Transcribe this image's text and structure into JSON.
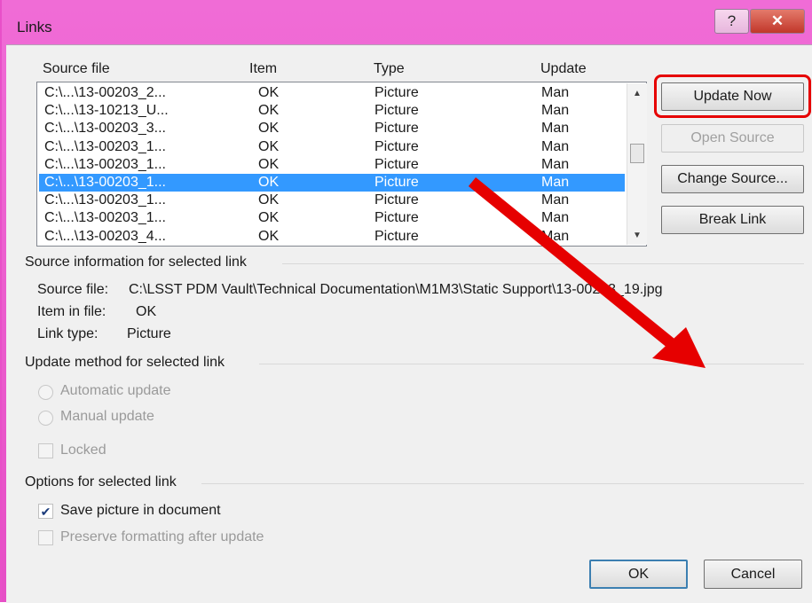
{
  "window": {
    "title": "Links",
    "help_label": "?",
    "close_label": "✕"
  },
  "list": {
    "headers": {
      "source_file": "Source file",
      "item": "Item",
      "type": "Type",
      "update": "Update"
    },
    "selected_index": 5,
    "rows": [
      {
        "source": "C:\\...\\13-00203_2...",
        "item": "OK",
        "type": "Picture",
        "update": "Man"
      },
      {
        "source": "C:\\...\\13-10213_U...",
        "item": "OK",
        "type": "Picture",
        "update": "Man"
      },
      {
        "source": "C:\\...\\13-00203_3...",
        "item": "OK",
        "type": "Picture",
        "update": "Man"
      },
      {
        "source": "C:\\...\\13-00203_1...",
        "item": "OK",
        "type": "Picture",
        "update": "Man"
      },
      {
        "source": "C:\\...\\13-00203_1...",
        "item": "OK",
        "type": "Picture",
        "update": "Man"
      },
      {
        "source": "C:\\...\\13-00203_1...",
        "item": "OK",
        "type": "Picture",
        "update": "Man"
      },
      {
        "source": "C:\\...\\13-00203_1...",
        "item": "OK",
        "type": "Picture",
        "update": "Man"
      },
      {
        "source": "C:\\...\\13-00203_1...",
        "item": "OK",
        "type": "Picture",
        "update": "Man"
      },
      {
        "source": "C:\\...\\13-00203_4...",
        "item": "OK",
        "type": "Picture",
        "update": "Man"
      }
    ]
  },
  "buttons": {
    "update_now": "Update Now",
    "open_source": "Open Source",
    "change_source": "Change Source...",
    "break_link": "Break Link",
    "ok": "OK",
    "cancel": "Cancel"
  },
  "source_info": {
    "section_title": "Source information for selected link",
    "source_file_label": "Source file:",
    "source_file_value": "C:\\LSST PDM Vault\\Technical Documentation\\M1M3\\Static Support\\13-00203_19.jpg",
    "item_label": "Item in file:",
    "item_value": "OK",
    "link_type_label": "Link type:",
    "link_type_value": "Picture"
  },
  "update_method": {
    "section_title": "Update method for selected link",
    "automatic": "Automatic update",
    "manual": "Manual update",
    "locked": "Locked"
  },
  "options": {
    "section_title": "Options for selected link",
    "save_picture": "Save picture in document",
    "save_picture_checked": true,
    "preserve_formatting": "Preserve formatting after update"
  },
  "annotation": {
    "highlight_color": "#e60000",
    "arrow_color": "#e60000"
  }
}
